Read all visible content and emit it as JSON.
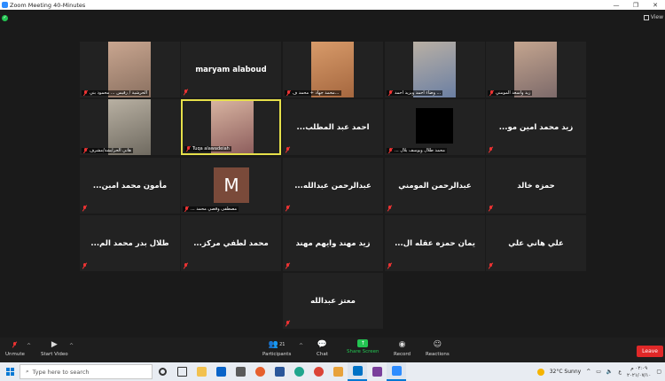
{
  "window": {
    "title": "Zoom Meeting 40-Minutes",
    "controls": [
      "—",
      "❐",
      "✕"
    ]
  },
  "view_label": "View",
  "tiles": [
    {
      "id": 1,
      "kind": "video",
      "label": "الحرشية / رقيس ... محمود بني",
      "video_colors": [
        "#8a7060",
        "#c9a690"
      ]
    },
    {
      "id": 2,
      "kind": "name",
      "name": "maryam alaboud"
    },
    {
      "id": 3,
      "kind": "video",
      "label": "محمد جهاد + محمد ف...",
      "video_colors": [
        "#a5673f",
        "#d89b6a"
      ]
    },
    {
      "id": 4,
      "kind": "video",
      "label": "وضاء احمد ويزيد احمد ...",
      "video_colors": [
        "#6b7fa3",
        "#b9b0a4"
      ]
    },
    {
      "id": 5,
      "kind": "video",
      "label": "زيد وأسعد المومني",
      "video_colors": [
        "#7d6a6a",
        "#c4a58f"
      ]
    },
    {
      "id": 6,
      "kind": "video",
      "label": "هاني الحرايشة/مشرف",
      "video_colors": [
        "#6f6a60",
        "#b8b0a2"
      ]
    },
    {
      "id": 7,
      "kind": "video",
      "label": "Tuqa alawadeiah",
      "active": true,
      "video_colors": [
        "#8a5a5a",
        "#d7b3a0"
      ]
    },
    {
      "id": 8,
      "kind": "name",
      "name": "...احمد عبد المطلب"
    },
    {
      "id": 9,
      "kind": "box",
      "label": "... محمد طلال ويوسف بلال"
    },
    {
      "id": 10,
      "kind": "name",
      "name": "...زيد محمد امين مو"
    },
    {
      "id": 11,
      "kind": "name",
      "name": "...مأمون محمد امين"
    },
    {
      "id": 12,
      "kind": "avatar",
      "initial": "M",
      "label": "... مصطفى وقصي محمد"
    },
    {
      "id": 13,
      "kind": "name",
      "name": "...عبدالرحمن عبدالله"
    },
    {
      "id": 14,
      "kind": "name",
      "name": "عبدالرحمن المومني"
    },
    {
      "id": 15,
      "kind": "name",
      "name": "حمزه خالد"
    },
    {
      "id": 16,
      "kind": "name",
      "name": "...طلال بدر محمد الم"
    },
    {
      "id": 17,
      "kind": "name",
      "name": "...محمد لطفي مركز"
    },
    {
      "id": 18,
      "kind": "name",
      "name": "زيد مهند وايهم مهند"
    },
    {
      "id": 19,
      "kind": "name",
      "name": "...يمان حمزه عقله ال"
    },
    {
      "id": 20,
      "kind": "name",
      "name": "علي هاني علي"
    },
    {
      "id": 21,
      "kind": "name",
      "name": "معتز عبدالله"
    }
  ],
  "toolbar": {
    "unmute": "Unmute",
    "start_video": "Start Video",
    "participants": "Participants",
    "participants_count": "21",
    "chat": "Chat",
    "share_screen": "Share Screen",
    "record": "Record",
    "reactions": "Reactions",
    "leave": "Leave"
  },
  "taskbar": {
    "search_placeholder": "Type here to search",
    "weather": "32°C  Sunny",
    "lang": "ع",
    "time": "٠٢:٠٩ م",
    "date": "٢٠٢١/٠٧/١٠"
  },
  "colors": {
    "accent": "#2d8cff",
    "share": "#23c552",
    "leave": "#e02828",
    "active_speaker": "#e6e04a"
  }
}
